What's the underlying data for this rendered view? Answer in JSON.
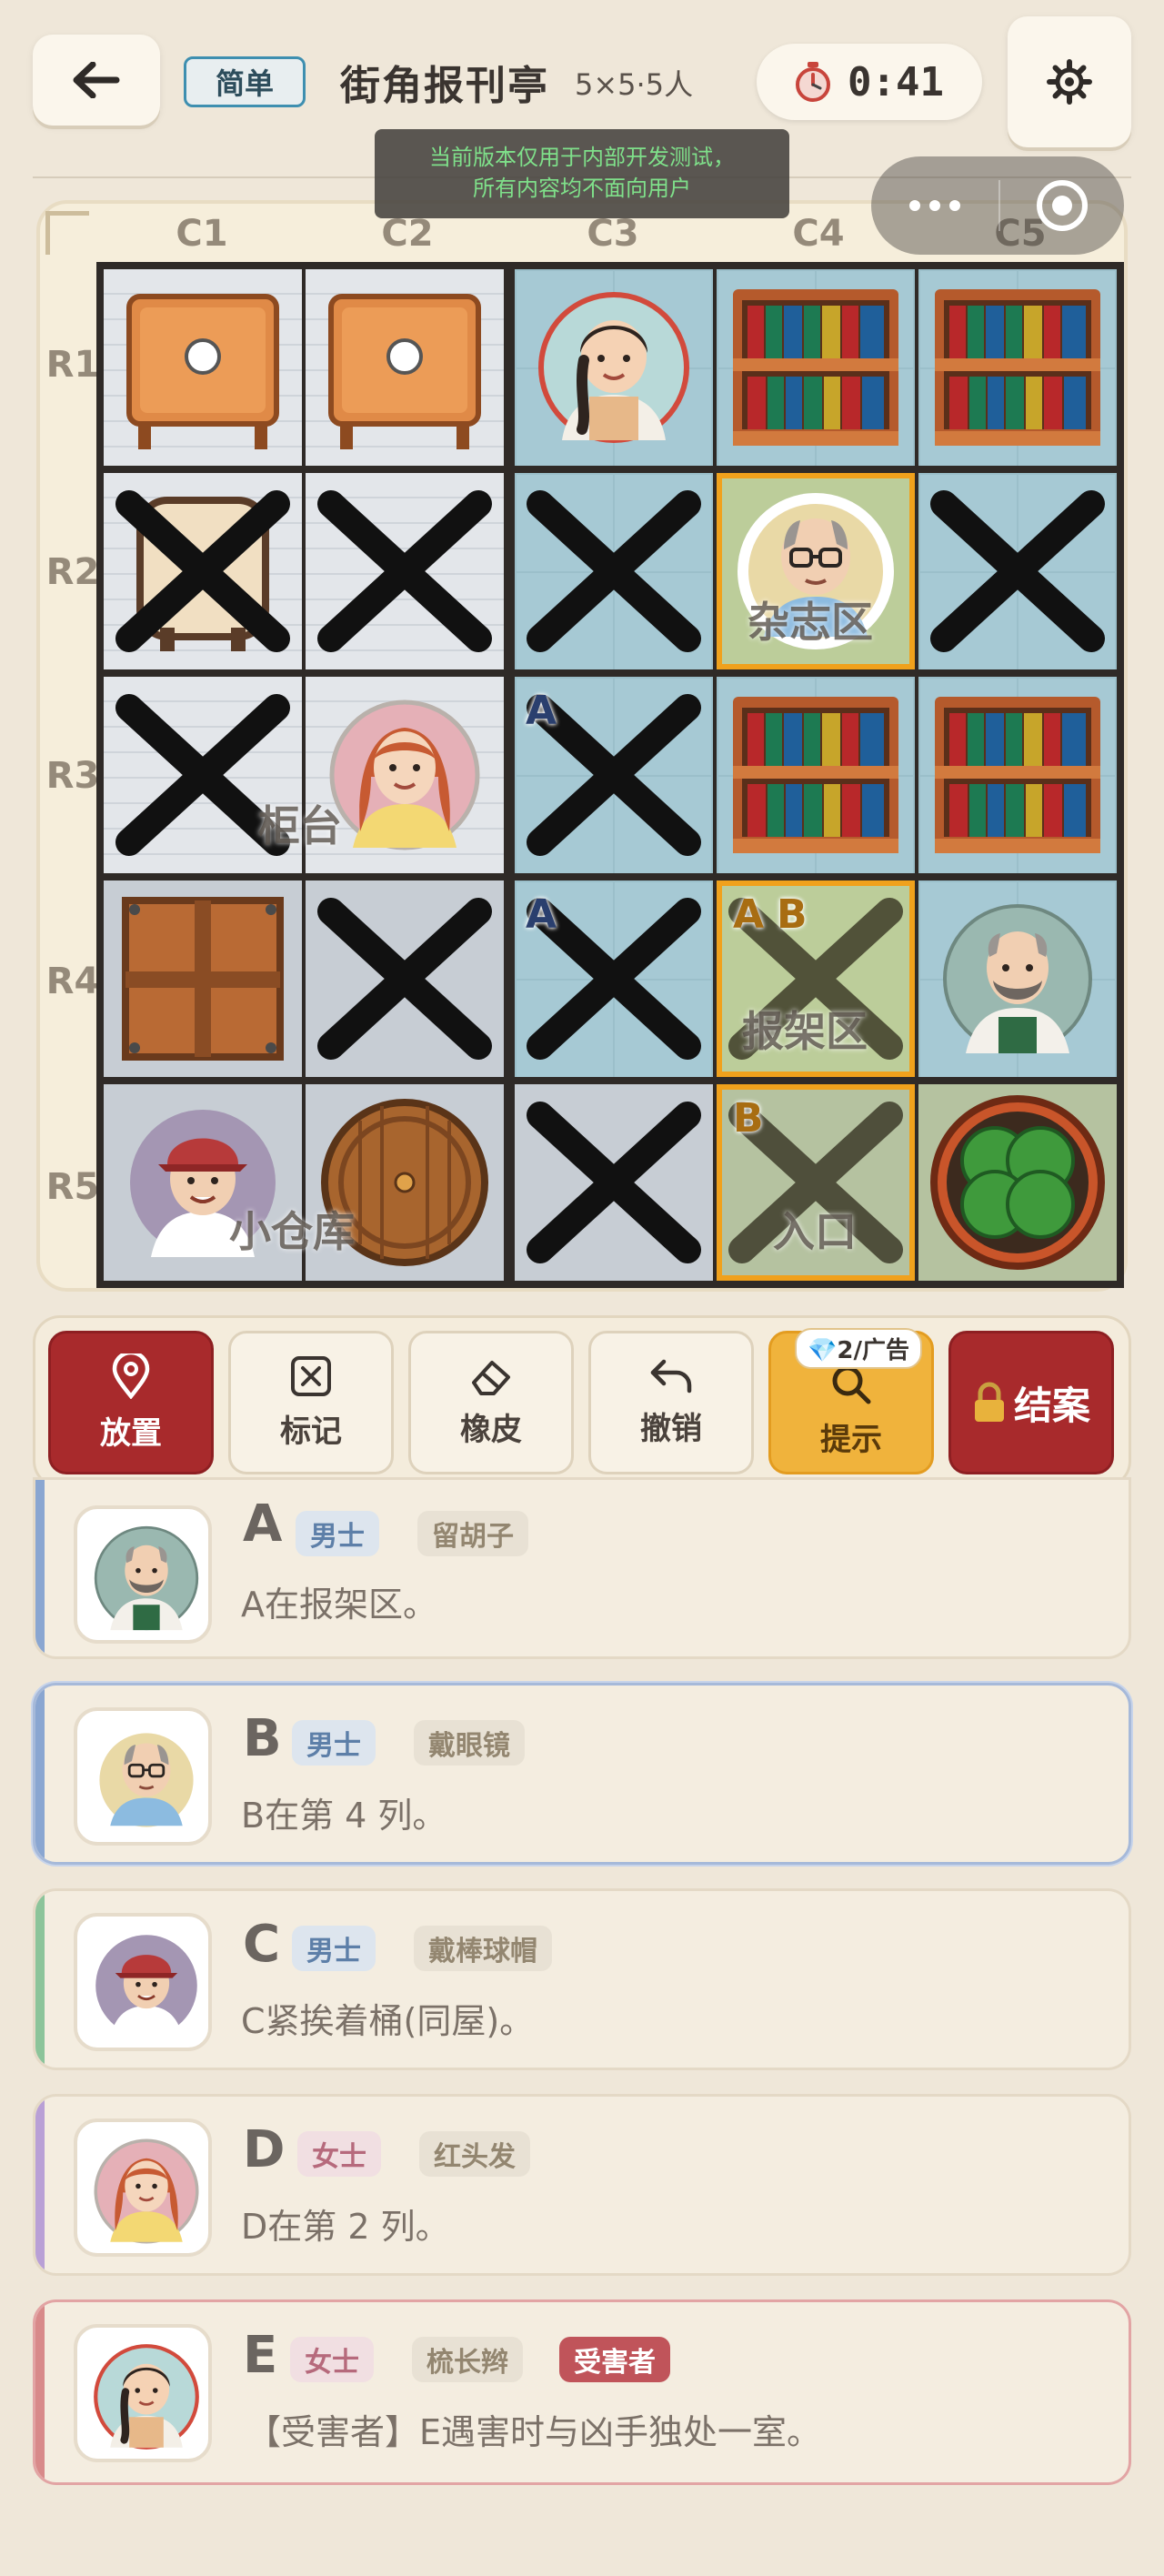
{
  "header": {
    "difficulty": "简单",
    "title": "街角报刊亭",
    "meta": "5×5·5人",
    "timer": "0:41"
  },
  "notice": {
    "line1": "当前版本仅用于内部开发测试，",
    "line2": "所有内容均不面向用户"
  },
  "board": {
    "columns": [
      "C1",
      "C2",
      "C3",
      "C4",
      "C5"
    ],
    "rows": [
      "R1",
      "R2",
      "R3",
      "R4",
      "R5"
    ],
    "zones": {
      "counter": "柜台",
      "reading": "杂志区",
      "rack": "报架区",
      "storage": "小仓库",
      "entrance": "入口"
    },
    "cell_marks": {
      "r3c3": "A",
      "r4c3": "A",
      "r4c4_a": "A",
      "r4c4_b": "B",
      "r5c4": "B"
    }
  },
  "toolbar": {
    "place": "放置",
    "mark": "标记",
    "eraser": "橡皮",
    "undo": "撤销",
    "hint": "提示",
    "hint_badge": "💎2/广告",
    "solve": "结案"
  },
  "suspects": [
    {
      "letter": "A",
      "gender": "男士",
      "trait": "留胡子",
      "clue": "A在报架区。",
      "stripe": "#8aa6d1"
    },
    {
      "letter": "B",
      "gender": "男士",
      "trait": "戴眼镜",
      "clue": "B在第 4 列。",
      "stripe": "#8aa6d1"
    },
    {
      "letter": "C",
      "gender": "男士",
      "trait": "戴棒球帽",
      "clue": "C紧挨着桶(同屋)。",
      "stripe": "#8cc49a"
    },
    {
      "letter": "D",
      "gender": "女士",
      "trait": "红头发",
      "clue": "D在第 2 列。",
      "stripe": "#b9a0d6"
    },
    {
      "letter": "E",
      "gender": "女士",
      "trait": "梳长辫",
      "victim_tag": "受害者",
      "clue": "【受害者】E遇害时与凶手独处一室。",
      "stripe": "#d88a8a"
    }
  ]
}
